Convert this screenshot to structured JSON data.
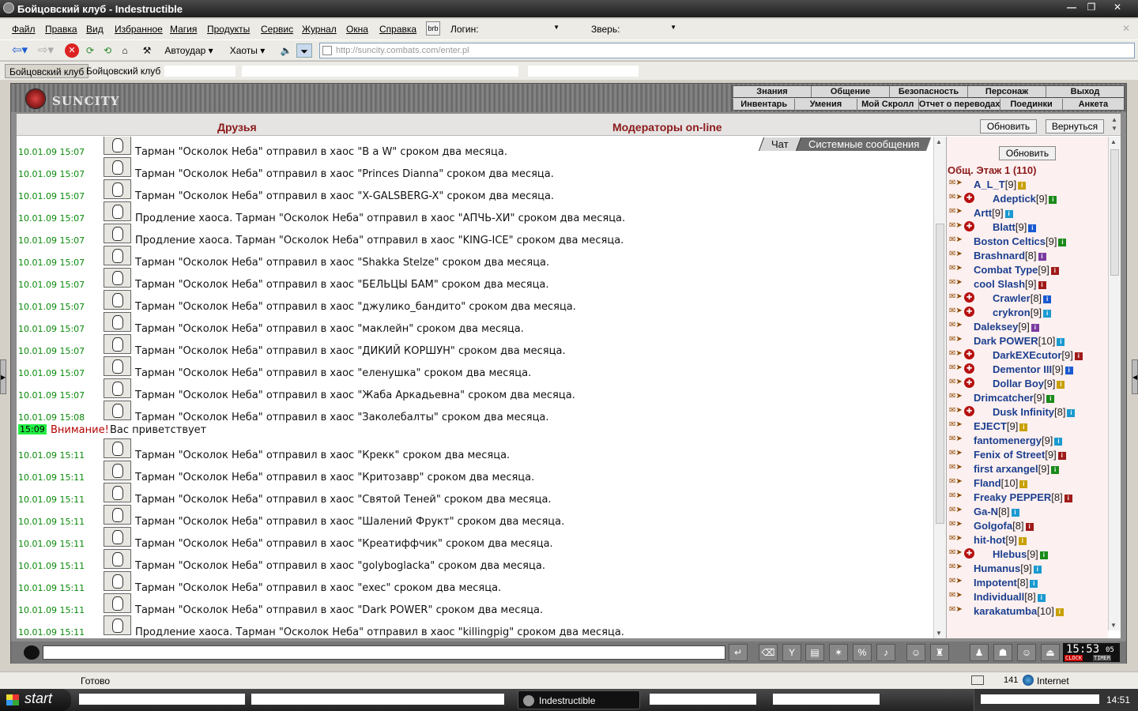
{
  "window": {
    "title": "Бойцовский клуб - Indestructible",
    "min": "—",
    "max": "❐",
    "close": "✕"
  },
  "menu": {
    "items": [
      "Файл",
      "Правка",
      "Вид",
      "Избранное",
      "Магия",
      "Продукты",
      "Сервис",
      "Журнал",
      "Окна",
      "Справка"
    ],
    "brb": "brb",
    "login_label": "Логин:",
    "pet_label": "Зверь:",
    "close": "✕"
  },
  "toolbar": {
    "autoudar": "Автоудар",
    "haoty": "Хаоты",
    "url": "http://suncity.combats.com/enter.pl"
  },
  "tabs": [
    "Бойцовский клуб",
    "Бойцовский клуб"
  ],
  "game": {
    "logo": "SUNCITY",
    "nav_top": [
      "Знания",
      "Общение",
      "Безопасность",
      "Персонаж",
      "Выход"
    ],
    "nav_bottom": [
      "Инвентарь",
      "Умения",
      "Мой Скролл",
      "Отчет о переводах",
      "Поединки",
      "Анкета"
    ]
  },
  "topbar": {
    "friends": "Друзья",
    "moderators": "Модераторы on-line",
    "refresh": "Обновить",
    "back": "Вернуться"
  },
  "chat_tabs": {
    "chat": "Чат",
    "system": "Системные сообщения"
  },
  "messages": [
    {
      "ts": "10.01.09 15:07",
      "text": "Тарман \"Осколок Неба\" отправил в хаос \"В а W\" сроком два месяца."
    },
    {
      "ts": "10.01.09 15:07",
      "text": "Тарман \"Осколок Неба\" отправил в хаос \"Princes Dianna\" сроком два месяца."
    },
    {
      "ts": "10.01.09 15:07",
      "text": "Тарман \"Осколок Неба\" отправил в хаос \"X-GALSBERG-X\" сроком два месяца."
    },
    {
      "ts": "10.01.09 15:07",
      "text": "Продление хаоса. Тарман \"Осколок Неба\" отправил в хаос \"АПЧЬ-ХИ\" сроком два месяца."
    },
    {
      "ts": "10.01.09 15:07",
      "text": "Продление хаоса. Тарман \"Осколок Неба\" отправил в хаос \"KING-ICE\" сроком два месяца."
    },
    {
      "ts": "10.01.09 15:07",
      "text": "Тарман \"Осколок Неба\" отправил в хаос \"Shakka Stelze\" сроком два месяца."
    },
    {
      "ts": "10.01.09 15:07",
      "text": "Тарман \"Осколок Неба\" отправил в хаос \"БЕЛЬЦЫ БАМ\" сроком два месяца."
    },
    {
      "ts": "10.01.09 15:07",
      "text": "Тарман \"Осколок Неба\" отправил в хаос \"джулико_бандито\" сроком два месяца."
    },
    {
      "ts": "10.01.09 15:07",
      "text": "Тарман \"Осколок Неба\" отправил в хаос \"маклейн\" сроком два месяца."
    },
    {
      "ts": "10.01.09 15:07",
      "text": "Тарман \"Осколок Неба\" отправил в хаос \"ДИКИЙ КОРШУН\" сроком два месяца."
    },
    {
      "ts": "10.01.09 15:07",
      "text": "Тарман \"Осколок Неба\" отправил в хаос \"еленушка\" сроком два месяца."
    },
    {
      "ts": "10.01.09 15:07",
      "text": "Тарман \"Осколок Неба\" отправил в хаос \"Жаба Аркадьевна\" сроком два месяца."
    },
    {
      "ts": "10.01.09 15:08",
      "text": "Тарман \"Осколок Неба\" отправил в хаос \"Заколебалты\" сроком два месяца."
    }
  ],
  "system_msg": {
    "ts": "15:09",
    "warn": "Внимание!",
    "text": "Вас приветствует"
  },
  "messages2": [
    {
      "ts": "10.01.09 15:11",
      "text": "Тарман \"Осколок Неба\" отправил в хаос \"Крекк\" сроком два месяца."
    },
    {
      "ts": "10.01.09 15:11",
      "text": "Тарман \"Осколок Неба\" отправил в хаос \"Критозавр\" сроком два месяца."
    },
    {
      "ts": "10.01.09 15:11",
      "text": "Тарман \"Осколок Неба\" отправил в хаос \"Святой Теней\" сроком два месяца."
    },
    {
      "ts": "10.01.09 15:11",
      "text": "Тарман \"Осколок Неба\" отправил в хаос \"Шалений Фрукт\" сроком два месяца."
    },
    {
      "ts": "10.01.09 15:11",
      "text": "Тарман \"Осколок Неба\" отправил в хаос \"Креатиффчик\" сроком два месяца."
    },
    {
      "ts": "10.01.09 15:11",
      "text": "Тарман \"Осколок Неба\" отправил в хаос \"golyboglacka\" сроком два месяца."
    },
    {
      "ts": "10.01.09 15:11",
      "text": "Тарман \"Осколок Неба\" отправил в хаос \"exec\" сроком два месяца."
    },
    {
      "ts": "10.01.09 15:11",
      "text": "Тарман \"Осколок Неба\" отправил в хаос \"Dark POWER\" сроком два месяца."
    },
    {
      "ts": "10.01.09 15:11",
      "text": "Продление хаоса. Тарман \"Осколок Неба\" отправил в хаос \"killingpig\" сроком два месяца."
    }
  ],
  "online": {
    "refresh": "Обновить",
    "floor": "Общ. Этаж 1 (110)",
    "users": [
      {
        "name": "A_L_T",
        "lv": "[9]",
        "badge": false,
        "ic": "#c8a000"
      },
      {
        "name": "Adeptick",
        "lv": "[9]",
        "badge": true,
        "ic": "#1a8a1a"
      },
      {
        "name": "Artt",
        "lv": "[9]",
        "badge": false,
        "ic": "#1a9ad0"
      },
      {
        "name": "Blatt",
        "lv": "[9]",
        "badge": true,
        "ic": "#1a5ad0"
      },
      {
        "name": "Boston Celtics",
        "lv": "[9]",
        "badge": false,
        "ic": "#1a8a1a"
      },
      {
        "name": "Brashnard",
        "lv": "[8]",
        "badge": false,
        "ic": "#7a3aa0"
      },
      {
        "name": "Combat Type",
        "lv": "[9]",
        "badge": false,
        "ic": "#a01a1a"
      },
      {
        "name": "cool Slash",
        "lv": "[9]",
        "badge": false,
        "ic": "#a01a1a"
      },
      {
        "name": "Crawler",
        "lv": "[8]",
        "badge": true,
        "ic": "#1a5ad0"
      },
      {
        "name": "crykron",
        "lv": "[9]",
        "badge": true,
        "ic": "#1a9ad0"
      },
      {
        "name": "Daleksey",
        "lv": "[9]",
        "badge": false,
        "ic": "#7a3aa0"
      },
      {
        "name": "Dark POWER",
        "lv": "[10]",
        "badge": false,
        "ic": "#1a9ad0"
      },
      {
        "name": "DarkEXEcutor",
        "lv": "[9]",
        "badge": true,
        "ic": "#a01a1a"
      },
      {
        "name": "Dementor III",
        "lv": "[9]",
        "badge": true,
        "ic": "#1a5ad0"
      },
      {
        "name": "Dollar Boy",
        "lv": "[9]",
        "badge": true,
        "ic": "#c8a000"
      },
      {
        "name": "Drimcatcher",
        "lv": "[9]",
        "badge": false,
        "ic": "#1a8a1a"
      },
      {
        "name": "Dusk Infinity",
        "lv": "[8]",
        "badge": true,
        "ic": "#1a9ad0"
      },
      {
        "name": "EJECT",
        "lv": "[9]",
        "badge": false,
        "ic": "#c8a000"
      },
      {
        "name": "fantomenergy",
        "lv": "[9]",
        "badge": false,
        "ic": "#1a9ad0"
      },
      {
        "name": "Fenix of Street",
        "lv": "[9]",
        "badge": false,
        "ic": "#a01a1a"
      },
      {
        "name": "first arxangel",
        "lv": "[9]",
        "badge": false,
        "ic": "#1a8a1a"
      },
      {
        "name": "Fland",
        "lv": "[10]",
        "badge": false,
        "ic": "#c8a000"
      },
      {
        "name": "Freaky PEPPER",
        "lv": "[8]",
        "badge": false,
        "ic": "#a01a1a"
      },
      {
        "name": "Ga-N",
        "lv": "[8]",
        "badge": false,
        "ic": "#1a9ad0"
      },
      {
        "name": "Golgofa",
        "lv": "[8]",
        "badge": false,
        "ic": "#a01a1a"
      },
      {
        "name": "hit-hot",
        "lv": "[9]",
        "badge": false,
        "ic": "#c8a000"
      },
      {
        "name": "Hlebus",
        "lv": "[9]",
        "badge": true,
        "ic": "#1a8a1a"
      },
      {
        "name": "Humanus",
        "lv": "[9]",
        "badge": false,
        "ic": "#1a9ad0"
      },
      {
        "name": "Impotent",
        "lv": "[8]",
        "badge": false,
        "ic": "#1a9ad0"
      },
      {
        "name": "Individuall",
        "lv": "[8]",
        "badge": false,
        "ic": "#1a9ad0"
      },
      {
        "name": "karakatumba",
        "lv": "[10]",
        "badge": false,
        "ic": "#c8a000"
      }
    ]
  },
  "clock": {
    "time": "15:53",
    "sec": "05",
    "clock_label": "CLOCK",
    "timer_label": "TIMER"
  },
  "status": {
    "text": "Готово",
    "count": "141",
    "zone": "Internet"
  },
  "taskbar": {
    "start": "start",
    "active": "Indestructible",
    "time": "14:51"
  }
}
